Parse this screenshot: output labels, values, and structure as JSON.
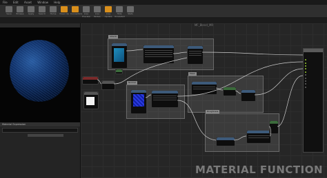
{
  "menubar": {
    "items": [
      "File",
      "Edit",
      "Asset",
      "Window",
      "Help"
    ]
  },
  "toolbar": {
    "buttons": [
      {
        "name": "save",
        "label": "Save"
      },
      {
        "name": "browse",
        "label": "Browse"
      },
      {
        "name": "apply",
        "label": "Apply"
      },
      {
        "name": "search",
        "label": "Search"
      },
      {
        "name": "home",
        "label": "Home"
      },
      {
        "name": "clean-up",
        "label": "Clean Up"
      },
      {
        "name": "connectors",
        "label": "Connectors"
      },
      {
        "name": "live-preview",
        "label": "Live Preview"
      },
      {
        "name": "live-nodes",
        "label": "Live Nodes"
      },
      {
        "name": "live-update",
        "label": "Live Update"
      },
      {
        "name": "hide-unrelated",
        "label": "Hide Unrelated"
      },
      {
        "name": "stats",
        "label": "Stats"
      }
    ]
  },
  "graph": {
    "title": "MF_Blend_MR",
    "watermark": "MATERIAL FUNCTION"
  },
  "comments": [
    {
      "title": "Albedo"
    },
    {
      "title": "Normal"
    },
    {
      "title": "Mask"
    },
    {
      "title": "Roughness"
    }
  ],
  "details": {
    "header": "Material Expression"
  },
  "colors": {
    "accent": "#d98f1c",
    "pin_green": "#9acd32",
    "thumb_blue": "#1f8fbf",
    "thumb_normal": "#1a28c9"
  }
}
